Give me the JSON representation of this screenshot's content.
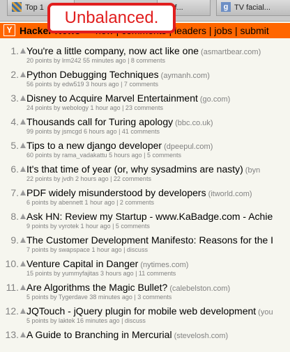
{
  "browser": {
    "tabs": [
      {
        "label": "Top 1"
      },
      {
        "label": "ate of..."
      },
      {
        "label": "TV facial..."
      }
    ]
  },
  "annotation": {
    "label": "Unbalanced."
  },
  "hn": {
    "logo": "Y",
    "name": "Hacker News",
    "nav": "new | comments | leaders | jobs | submit"
  },
  "items": [
    {
      "rank": "1.",
      "title": "You're a little company, now act like one",
      "site": "(asmartbear.com)",
      "sub": "20 points by lrm242 55 minutes ago | 8 comments"
    },
    {
      "rank": "2.",
      "title": "Python Debugging Techniques",
      "site": "(aymanh.com)",
      "sub": "56 points by edw519 3 hours ago | 7 comments"
    },
    {
      "rank": "3.",
      "title": "Disney to Acquire Marvel Entertainment",
      "site": "(go.com)",
      "sub": "24 points by webology 1 hour ago | 23 comments"
    },
    {
      "rank": "4.",
      "title": "Thousands call for Turing apology",
      "site": "(bbc.co.uk)",
      "sub": "99 points by jsmcgd 6 hours ago | 41 comments"
    },
    {
      "rank": "5.",
      "title": "Tips to a new django developer",
      "site": "(dpeepul.com)",
      "sub": "60 points by rama_vadakattu 5 hours ago | 5 comments"
    },
    {
      "rank": "6.",
      "title": "It's that time of year (or, why sysadmins are nasty)",
      "site": "(byn",
      "sub": "22 points by jvdh 2 hours ago | 22 comments"
    },
    {
      "rank": "7.",
      "title": "PDF widely misunderstood by developers",
      "site": "(itworld.com)",
      "sub": "6 points by abennett 1 hour ago | 2 comments"
    },
    {
      "rank": "8.",
      "title": "Ask HN: Review my Startup - www.KaBadge.com - Achie",
      "site": "",
      "sub": "9 points by vyrotek 1 hour ago | 5 comments"
    },
    {
      "rank": "9.",
      "title": "The Customer Development Manifesto: Reasons for the I",
      "site": "",
      "sub": "7 points by swapspace 1 hour ago | discuss"
    },
    {
      "rank": "10.",
      "title": "Venture Capital in Danger",
      "site": "(nytimes.com)",
      "sub": "15 points by yummyfajitas 3 hours ago | 11 comments"
    },
    {
      "rank": "11.",
      "title": "Are Algorithms the Magic Bullet?",
      "site": "(calebelston.com)",
      "sub": "5 points by Tygerdave 38 minutes ago | 3 comments"
    },
    {
      "rank": "12.",
      "title": "JQTouch - jQuery plugin for mobile web development",
      "site": "(you",
      "sub": "5 points by laktek 16 minutes ago | discuss"
    },
    {
      "rank": "13.",
      "title": "A Guide to Branching in Mercurial",
      "site": "(stevelosh.com)",
      "sub": ""
    }
  ]
}
